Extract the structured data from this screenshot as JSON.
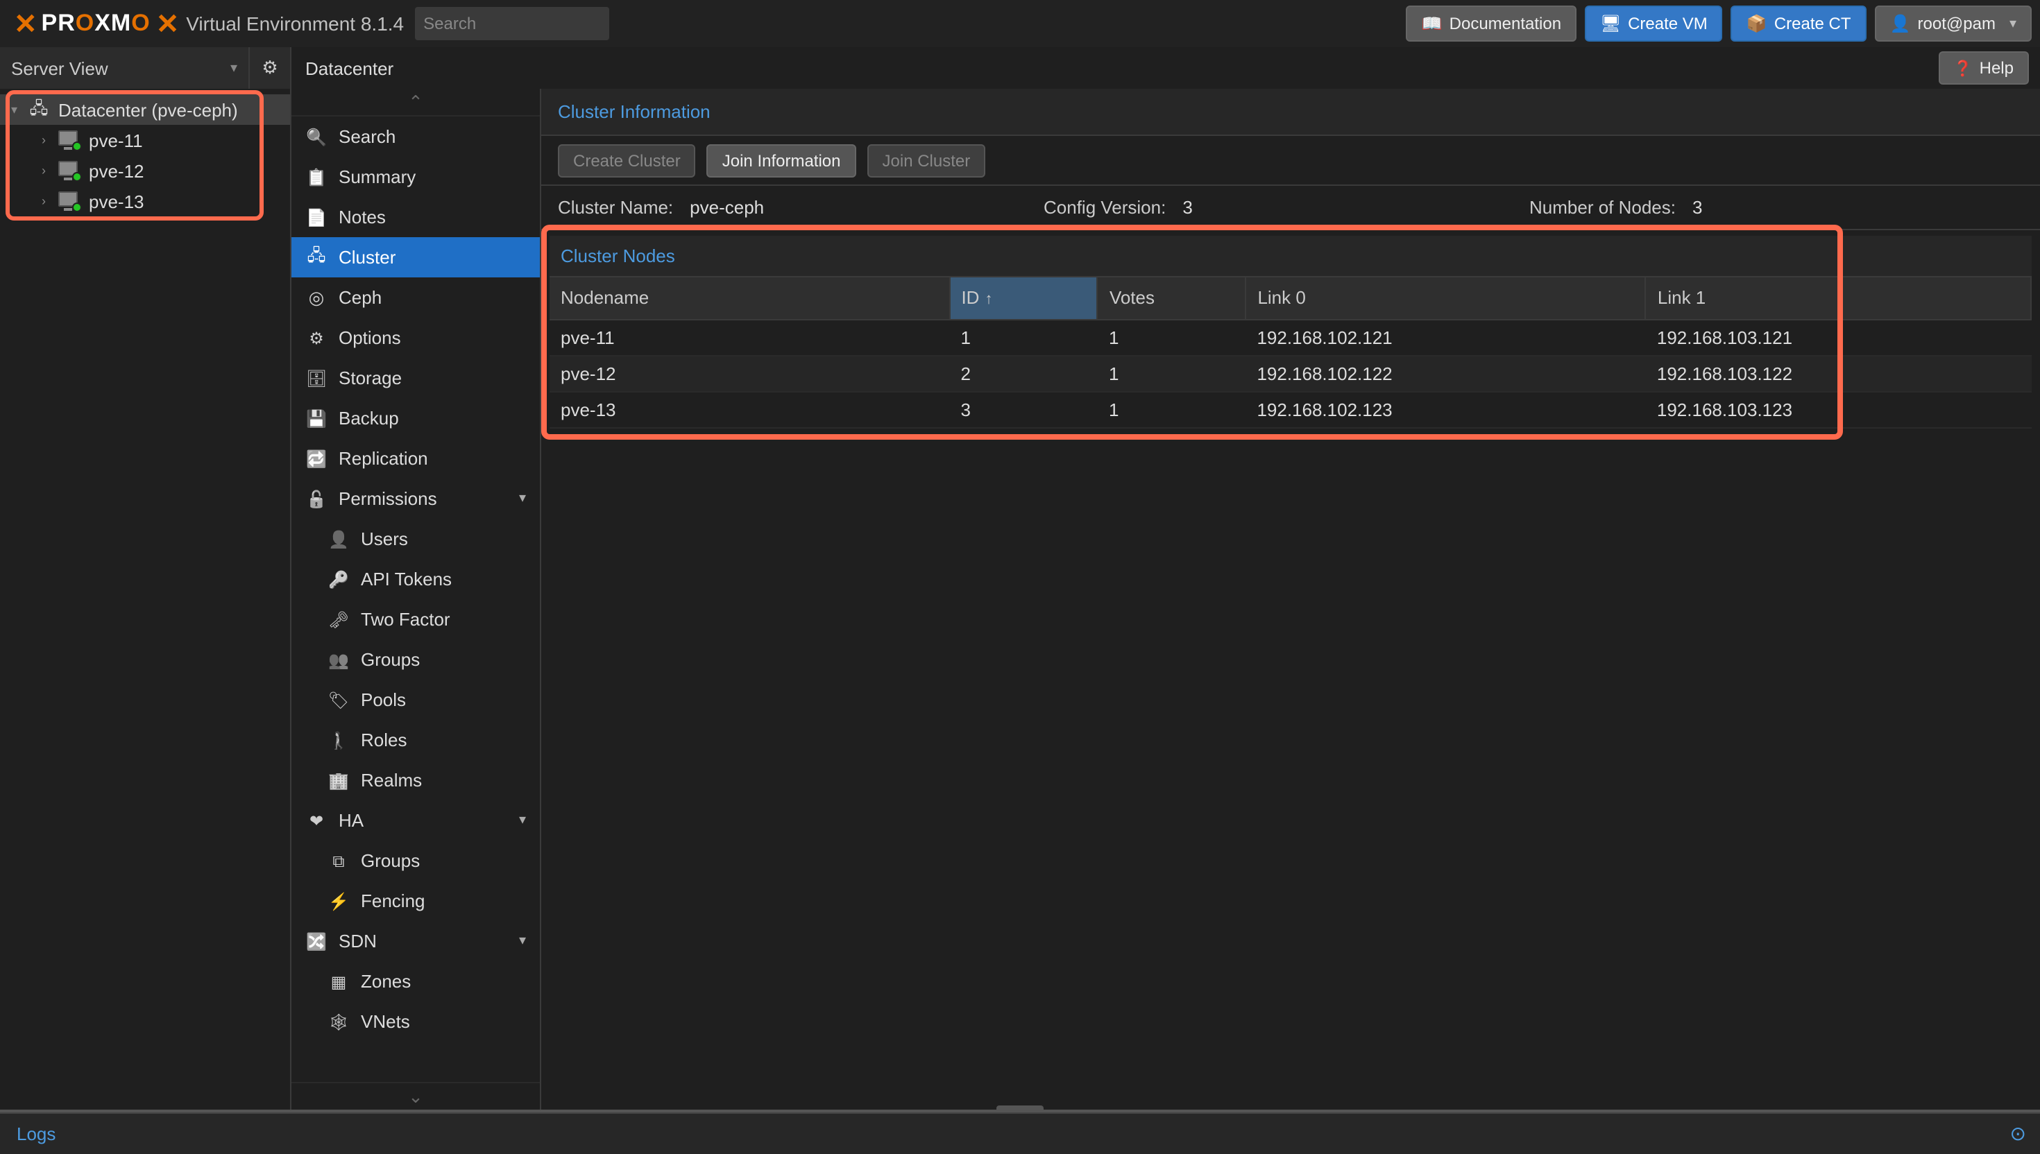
{
  "topbar": {
    "brand_pre": "PR",
    "brand_o1": "O",
    "brand_mid": "XM",
    "brand_o2": "O",
    "brand_end": "X",
    "env": "Virtual Environment 8.1.4",
    "search_placeholder": "Search",
    "doc": "Documentation",
    "create_vm": "Create VM",
    "create_ct": "Create CT",
    "user": "root@pam"
  },
  "row2": {
    "server_view": "Server View",
    "breadcrumb": "Datacenter",
    "help": "Help"
  },
  "tree": {
    "root": "Datacenter (pve-ceph)",
    "nodes": [
      "pve-11",
      "pve-12",
      "pve-13"
    ]
  },
  "nav": {
    "items": [
      {
        "label": "Search",
        "icon": "i-search"
      },
      {
        "label": "Summary",
        "icon": "i-clip"
      },
      {
        "label": "Notes",
        "icon": "i-note"
      },
      {
        "label": "Cluster",
        "icon": "i-cluster",
        "selected": true
      },
      {
        "label": "Ceph",
        "icon": "i-ceph"
      },
      {
        "label": "Options",
        "icon": "i-cog"
      },
      {
        "label": "Storage",
        "icon": "i-db"
      },
      {
        "label": "Backup",
        "icon": "i-save"
      },
      {
        "label": "Replication",
        "icon": "i-repl"
      },
      {
        "label": "Permissions",
        "icon": "i-lock",
        "expand": true
      },
      {
        "label": "Users",
        "icon": "i-person",
        "sub": true
      },
      {
        "label": "API Tokens",
        "icon": "i-key",
        "sub": true
      },
      {
        "label": "Two Factor",
        "icon": "i-2fa",
        "sub": true
      },
      {
        "label": "Groups",
        "icon": "i-group",
        "sub": true
      },
      {
        "label": "Pools",
        "icon": "i-pool",
        "sub": true
      },
      {
        "label": "Roles",
        "icon": "i-role",
        "sub": true
      },
      {
        "label": "Realms",
        "icon": "i-realm",
        "sub": true
      },
      {
        "label": "HA",
        "icon": "i-ha",
        "expand": true
      },
      {
        "label": "Groups",
        "icon": "i-grp",
        "sub": true
      },
      {
        "label": "Fencing",
        "icon": "i-fence",
        "sub": true
      },
      {
        "label": "SDN",
        "icon": "i-sdn",
        "expand": true
      },
      {
        "label": "Zones",
        "icon": "i-zones",
        "sub": true
      },
      {
        "label": "VNets",
        "icon": "i-vnet",
        "sub": true
      }
    ]
  },
  "content": {
    "section_title": "Cluster Information",
    "buttons": {
      "create": "Create Cluster",
      "join_info": "Join Information",
      "join": "Join Cluster"
    },
    "info": {
      "name_label": "Cluster Name:",
      "name": "pve-ceph",
      "cfg_label": "Config Version:",
      "cfg": "3",
      "nodes_label": "Number of Nodes:",
      "nodes": "3"
    },
    "nodes_title": "Cluster Nodes",
    "cols": {
      "name": "Nodename",
      "id": "ID",
      "votes": "Votes",
      "l0": "Link 0",
      "l1": "Link 1"
    },
    "rows": [
      {
        "name": "pve-11",
        "id": "1",
        "votes": "1",
        "l0": "192.168.102.121",
        "l1": "192.168.103.121"
      },
      {
        "name": "pve-12",
        "id": "2",
        "votes": "1",
        "l0": "192.168.102.122",
        "l1": "192.168.103.122"
      },
      {
        "name": "pve-13",
        "id": "3",
        "votes": "1",
        "l0": "192.168.102.123",
        "l1": "192.168.103.123"
      }
    ]
  },
  "logs": {
    "label": "Logs"
  }
}
